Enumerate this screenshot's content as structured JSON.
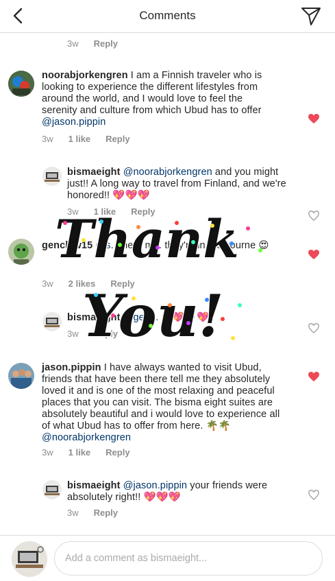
{
  "header": {
    "title": "Comments",
    "back_icon": "chevron-left-icon",
    "send_icon": "paper-plane-icon"
  },
  "top_meta": {
    "time": "3w",
    "reply": "Reply"
  },
  "comments": [
    {
      "username": "noorabjorkengren",
      "text": " I am a Finnish traveler who is looking to experience the different lifestyles from around the world, and I would love to feel the serenity and culture from which Ubud has to offer ",
      "mention": "@jason.pippin",
      "time": "3w",
      "likes": "1 like",
      "reply": "Reply",
      "liked": true
    },
    {
      "username": "bismaeight",
      "mention": "@noorabjorkengren",
      "text": " and you might just!! A long way to travel from Finland, and we're honored!! ",
      "emoji": "💖💖💖",
      "time": "3w",
      "likes": "1 like",
      "reply": "Reply",
      "liked": false
    },
    {
      "username": "genclaw15",
      "mention": "@s",
      "text": "... hear m... they're in Melbourne ",
      "emoji": "😍",
      "time": "3w",
      "likes": "2 likes",
      "reply": "Reply",
      "liked": true
    },
    {
      "username": "bismaeight",
      "mention": "@gen",
      "text": "... ",
      "emoji": "😆💖🌴💖",
      "time": "3w",
      "reply": "Reply",
      "liked": false
    },
    {
      "username": "jason.pippin",
      "text": " I have always wanted to visit Ubud, friends that have been there tell me they absolutely loved it and is one of the most relaxing and peaceful places that you can visit. The bisma eight suites are absolutely beautiful and i would love to experience all of what Ubud has to offer from here. ",
      "emoji": "🌴🌴",
      "mention": "@noorabjorkengren",
      "time": "3w",
      "likes": "1 like",
      "reply": "Reply",
      "liked": true
    },
    {
      "username": "bismaeight",
      "mention": "@jason.pippin",
      "text": " your friends were absolutely right!! ",
      "emoji": "💖💖💖",
      "time": "3w",
      "reply": "Reply",
      "liked": false
    }
  ],
  "overlay": {
    "line1": "Thank",
    "line2": "You!"
  },
  "composer": {
    "placeholder": "Add a comment as bismaeight..."
  },
  "colors": {
    "liked": "#ed4956",
    "mention": "#003569",
    "meta": "#8e8e8e"
  }
}
